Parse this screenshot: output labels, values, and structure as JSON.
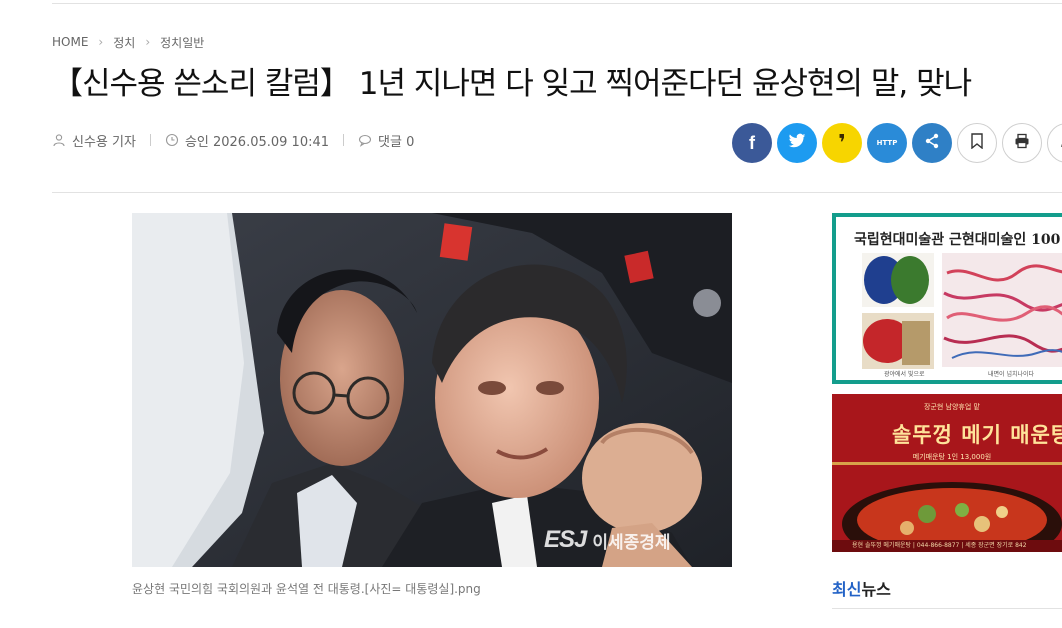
{
  "breadcrumb": {
    "home": "HOME",
    "level1": "정치",
    "level2": "정치일반"
  },
  "headline": "【신수용 쓴소리 칼럼】 1년 지나면 다 잊고 찍어준다던 윤상현의 말, 맞나",
  "meta": {
    "author": "신수용 기자",
    "approved": "승인 2026.05.09 10:41",
    "comments": "댓글 0"
  },
  "share": {
    "facebook": "f",
    "kakao_story": "❜",
    "http_label": "HTTP"
  },
  "photo": {
    "watermark_logo": "ESJ",
    "watermark_text": "이세종경제",
    "caption": "윤상현 국민의힘 국회의원과 윤석열 전 대통령.[사진= 대통령실].png"
  },
  "ads": {
    "ad1": {
      "title": "국립현대미술관 근현대미술인 100",
      "caption_left": "광야에서 빛으로",
      "caption_right": "내면이 넘치나이다"
    },
    "ad2": {
      "top_text": "장군현 남양휴업 맡",
      "headline": "솔뚜껑 메기 매운탕",
      "sub_text": "메기매운탕 1인 13,000원",
      "footer": "용현 솔뚜껑 메기매운탕 | 044-866-8877 | 세종 장군면 장기로 842"
    }
  },
  "latest": {
    "highlight": "최신",
    "rest": "뉴스"
  },
  "colors": {
    "facebook": "#3b5998",
    "twitter": "#1d9bf0",
    "kakao": "#f7d500",
    "link": "#2a8bd8",
    "accent_blue": "#2262c6",
    "ad1_border": "#139d8c",
    "ad2_bg": "#a8161b"
  }
}
